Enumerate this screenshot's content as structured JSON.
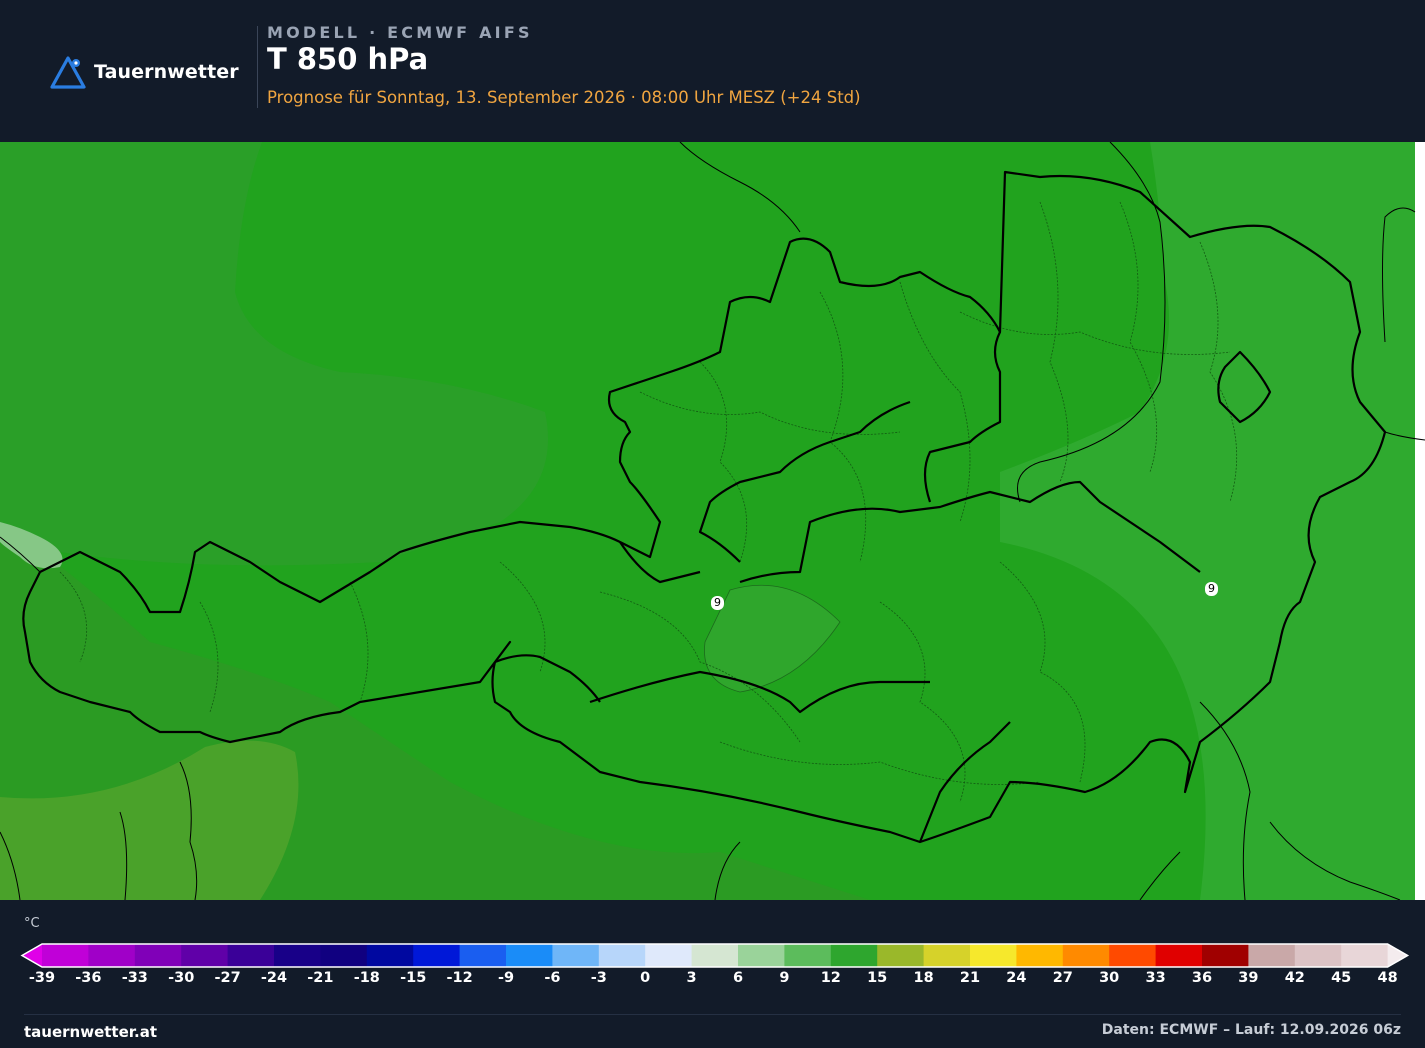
{
  "header": {
    "brand": "Tauernwetter",
    "model_line": "MODELL · ECMWF AIFS",
    "title": "T 850 hPa",
    "subtitle": "Prognose für Sonntag, 13. September 2026 · 08:00 Uhr MESZ  (+24 Std)"
  },
  "map": {
    "isolines": [
      {
        "label": "9"
      },
      {
        "label": "9"
      }
    ],
    "colors": {
      "main_fill": "#1ba61b",
      "east_fill": "#2faa2f",
      "west_fill": "#2d9e2d",
      "yellowgreen_fill": "#4aa22a",
      "border": "#000000"
    }
  },
  "legend": {
    "unit": "°C",
    "colors": [
      "#e000e8",
      "#c000d8",
      "#a000c8",
      "#8000b8",
      "#6000a8",
      "#3a0098",
      "#180088",
      "#100080",
      "#0008a0",
      "#0018d8",
      "#1a5ef0",
      "#1a8cf8",
      "#6fb6f8",
      "#b7d6fa",
      "#dfe9fb",
      "#d5e6d2",
      "#9ad39a",
      "#5cbc5c",
      "#2ea62e",
      "#9ab82a",
      "#d6d22a",
      "#f6e82c",
      "#ffb800",
      "#ff8a00",
      "#ff4a00",
      "#e00000",
      "#a00000",
      "#c9a8a8",
      "#dcc3c5",
      "#e8d6d8",
      "#f4ecee"
    ],
    "ticks": [
      "-39",
      "-36",
      "-33",
      "-30",
      "-27",
      "-24",
      "-21",
      "-18",
      "-15",
      "-12",
      "-9",
      "-6",
      "-3",
      "0",
      "3",
      "6",
      "9",
      "12",
      "15",
      "18",
      "21",
      "24",
      "27",
      "30",
      "33",
      "36",
      "39",
      "42",
      "45",
      "48"
    ]
  },
  "footer": {
    "site": "tauernwetter.at",
    "credit": "Daten: ECMWF – Lauf: 12.09.2026 06z"
  }
}
